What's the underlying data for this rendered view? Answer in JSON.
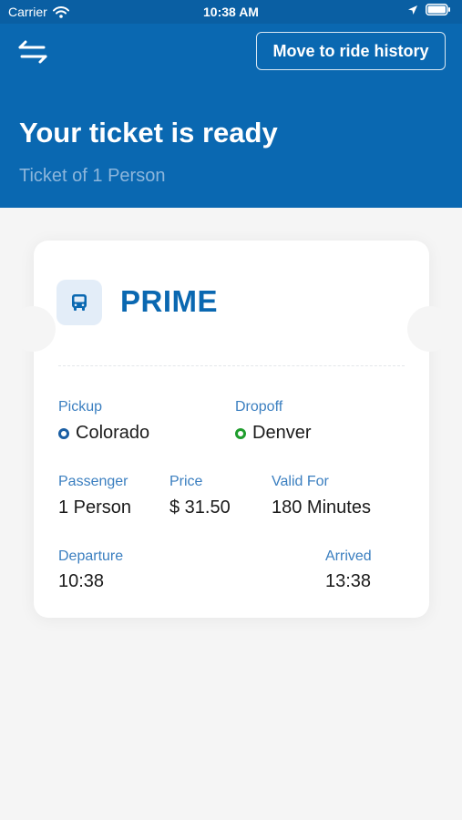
{
  "status_bar": {
    "carrier": "Carrier",
    "time": "10:38 AM"
  },
  "header": {
    "history_button": "Move to ride history",
    "title": "Your ticket is ready",
    "subtitle": "Ticket of 1 Person"
  },
  "ticket": {
    "type": "PRIME",
    "pickup": {
      "label": "Pickup",
      "value": "Colorado",
      "dot_color": "#1a5ea3"
    },
    "dropoff": {
      "label": "Dropoff",
      "value": "Denver",
      "dot_color": "#1f9d2d"
    },
    "passenger": {
      "label": "Passenger",
      "value": "1 Person"
    },
    "price": {
      "label": "Price",
      "value": "$ 31.50"
    },
    "valid_for": {
      "label": "Valid For",
      "value": "180 Minutes"
    },
    "departure": {
      "label": "Departure",
      "value": "10:38"
    },
    "arrived": {
      "label": "Arrived",
      "value": "13:38"
    }
  },
  "colors": {
    "primary": "#0a68b1",
    "label": "#3b7fc0",
    "subtitle": "#8cb6dc",
    "background": "#f5f5f5"
  },
  "icons": [
    "wifi-icon",
    "location-arrow-icon",
    "battery-icon",
    "swap-icon",
    "bus-icon"
  ]
}
